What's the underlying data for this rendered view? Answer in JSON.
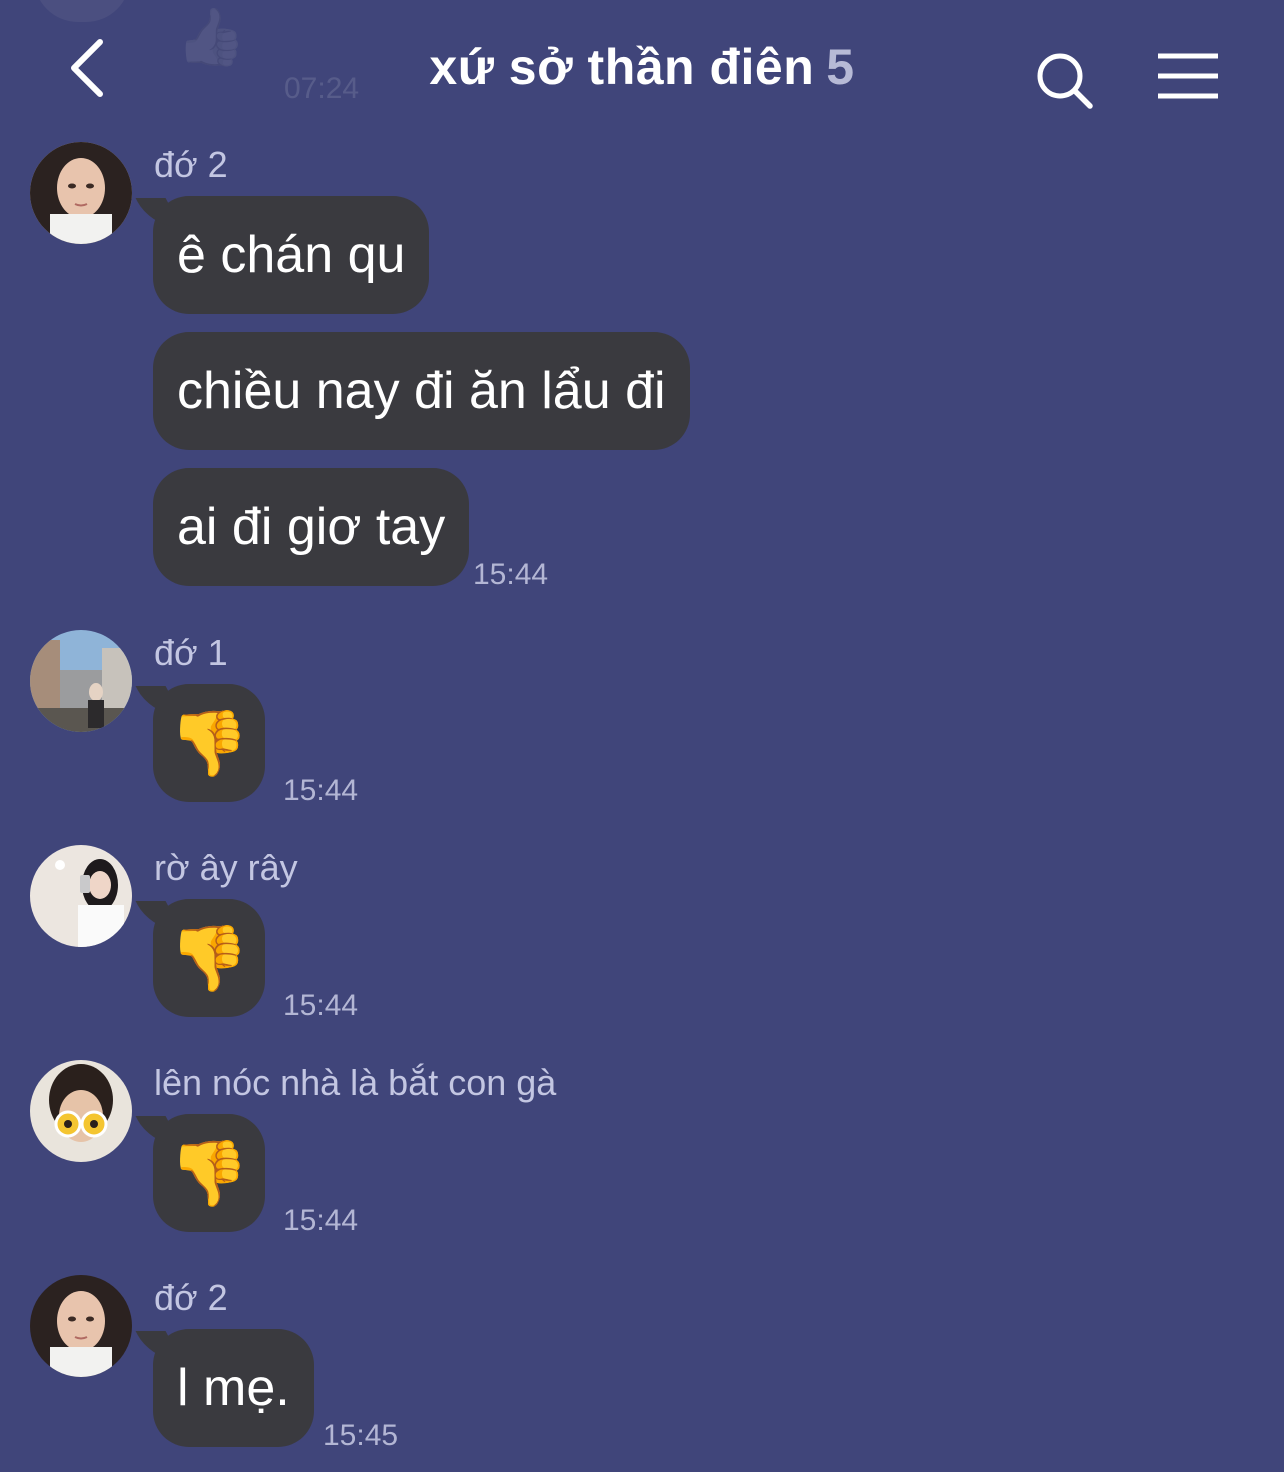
{
  "header": {
    "title": "xứ sở thần điên",
    "member_count": "5",
    "ghost_time": "07:24",
    "ghost_emoji": "👍"
  },
  "messages": [
    {
      "sender": "đớ 2",
      "bubbles": [
        "ê chán qu",
        "chiều nay đi ăn lẩu đi",
        "ai đi giơ tay"
      ],
      "time": "15:44"
    },
    {
      "sender": "đớ 1",
      "bubbles": [
        "👎"
      ],
      "time": "15:44"
    },
    {
      "sender": "rờ ây rây",
      "bubbles": [
        "👎"
      ],
      "time": "15:44"
    },
    {
      "sender": "lên nóc nhà là bắt con gà",
      "bubbles": [
        "👎"
      ],
      "time": "15:44"
    },
    {
      "sender": "đớ 2",
      "bubbles": [
        "l mẹ."
      ],
      "time": "15:45"
    }
  ],
  "colors": {
    "background": "#40457a",
    "bubble": "#3a3a3f",
    "sender_text": "#c3c6e2",
    "time_text": "#b3b6d4"
  },
  "icons": [
    "back-chevron-icon",
    "search-icon",
    "menu-icon"
  ]
}
